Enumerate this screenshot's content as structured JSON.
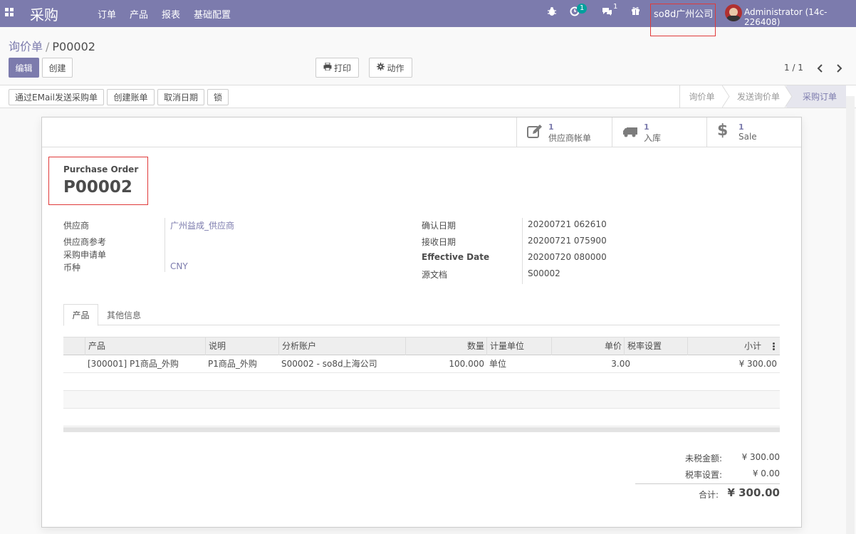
{
  "navbar": {
    "app_name": "采购",
    "menu": [
      "订单",
      "产品",
      "报表",
      "基础配置"
    ],
    "icons": [
      "bug-icon",
      "activity-icon",
      "chat-icon",
      "gift-icon"
    ],
    "activity_count": "1",
    "message_count": "1",
    "company": "so8d广州公司",
    "user": "Administrator (14c-226408)"
  },
  "breadcrumb": {
    "parent": "询价单",
    "separator": "/",
    "current": "P00002"
  },
  "toolbar": {
    "edit": "编辑",
    "create": "创建",
    "print": "打印",
    "action": "动作"
  },
  "pager": {
    "value": "1 / 1"
  },
  "statusbar": {
    "buttons": [
      "通过EMail发送采购单",
      "创建账单",
      "取消日期",
      "锁"
    ],
    "stages": [
      "询价单",
      "发送询价单",
      "采购订单"
    ],
    "active_stage": "采购订单"
  },
  "smart_buttons": [
    {
      "count": "1",
      "label": "供应商帐单",
      "icon": "edit-icon"
    },
    {
      "count": "1",
      "label": "入库",
      "icon": "truck-icon"
    },
    {
      "count": "1",
      "label": "Sale",
      "icon": "dollar-icon"
    }
  ],
  "document": {
    "type": "Purchase Order",
    "name": "P00002"
  },
  "left_fields": [
    {
      "label": "供应商",
      "value": "广州益成_供应商"
    },
    {
      "label": "供应商参考",
      "value": ""
    },
    {
      "label": "采购申请单",
      "value": ""
    },
    {
      "label": "币种",
      "value": "CNY"
    }
  ],
  "right_fields": [
    {
      "label": "确认日期",
      "value": "20200721 062610"
    },
    {
      "label": "接收日期",
      "value": "20200721 075900"
    },
    {
      "label": "Effective Date",
      "value": "20200720 080000"
    },
    {
      "label": "源文档",
      "value": "S00002"
    }
  ],
  "tabs": [
    "产品",
    "其他信息"
  ],
  "table": {
    "headers": [
      "产品",
      "说明",
      "分析账户",
      "数量",
      "计量单位",
      "单价",
      "税率设置",
      "小计"
    ],
    "rows": [
      [
        "[300001] P1商品_外购",
        "P1商品_外购",
        "S00002 - so8d上海公司",
        "100.000",
        "单位",
        "3.00",
        "",
        "¥ 300.00"
      ]
    ]
  },
  "totals": {
    "untaxed_label": "未税金额:",
    "untaxed_value": "¥ 300.00",
    "tax_label": "税率设置:",
    "tax_value": "¥ 0.00",
    "total_label": "合计:",
    "total_value": "¥ 300.00"
  },
  "colors": {
    "brand": "#7c7bad",
    "badge": "#00a09d",
    "highlight_box": "#e03a3a"
  }
}
